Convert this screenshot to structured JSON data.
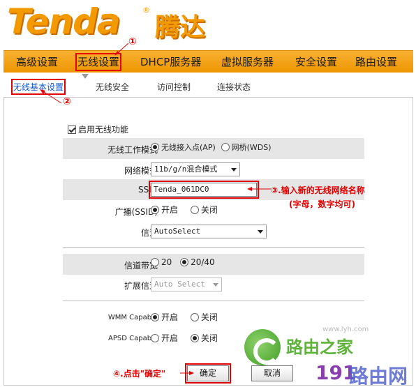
{
  "header": {
    "logo_text": "Tenda",
    "logo_reg": "®",
    "logo_cn": "腾达"
  },
  "nav": {
    "items": [
      {
        "label": "高级设置"
      },
      {
        "label": "无线设置"
      },
      {
        "label": "DHCP服务器"
      },
      {
        "label": "虚拟服务器"
      },
      {
        "label": "安全设置"
      },
      {
        "label": "路由设置"
      }
    ]
  },
  "subnav": {
    "items": [
      {
        "label": "无线基本设置"
      },
      {
        "label": "无线安全"
      },
      {
        "label": "访问控制"
      },
      {
        "label": "连接状态"
      }
    ]
  },
  "form": {
    "enable_wireless": "启用无线功能",
    "mode_label": "无线工作模式",
    "mode_ap": "无线接入点(AP)",
    "mode_wds": "网桥(WDS)",
    "net_mode_label": "网络模式",
    "net_mode_value": "11b/g/n混合模式",
    "ssid_label": "SSID",
    "ssid_value": "Tenda_061DC0",
    "broadcast_label": "广播(SSID)",
    "broadcast_on": "开启",
    "broadcast_off": "关闭",
    "channel_label": "信道",
    "channel_value": "AutoSelect",
    "bandwidth_label": "信道带宽",
    "bandwidth_20": "20",
    "bandwidth_2040": "20/40",
    "ext_channel_label": "扩展信道",
    "ext_channel_value": "Auto Select",
    "wmm_label": "WMM Capable",
    "wmm_on": "开启",
    "wmm_off": "关闭",
    "apsd_label": "APSD Capable",
    "apsd_on": "开启",
    "apsd_off": "关闭"
  },
  "buttons": {
    "ok": "确定",
    "cancel": "取消"
  },
  "annotations": {
    "one": "①",
    "two": "②",
    "three_line1": "③.输入新的无线网络名称",
    "three_line2": "(字母，数字均可)",
    "four": "④.点击\"确定\""
  },
  "watermark": {
    "cn": "路由之家",
    "url": "www.lyh.com",
    "site_num": "191",
    "site_cn": "路由网"
  },
  "colors": {
    "brand_orange": "#f39a00",
    "annotation_red": "#e30000",
    "active_link": "#1155cc"
  }
}
